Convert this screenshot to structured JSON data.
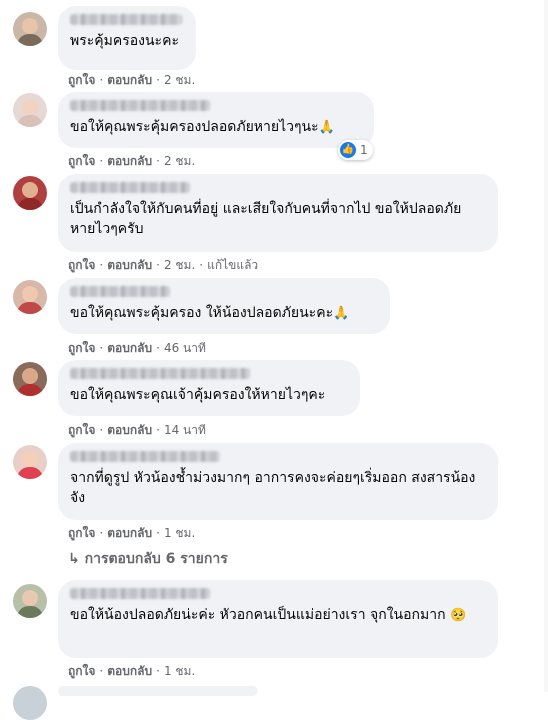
{
  "actions": {
    "like": "ถูกใจ",
    "reply": "ตอบกลับ",
    "separator": "·"
  },
  "comments": [
    {
      "text": "พระคุ้มครองนะคะ",
      "time": "2 ชม.",
      "edited": ""
    },
    {
      "text": "ขอให้คุณพระคุ้มครองปลอดภัยหายไวๆนะ",
      "emoji": "🙏",
      "time": "2 ชม.",
      "reactions": "1"
    },
    {
      "text": "เป็นกำลังใจให้กับคนที่อยู่ และเสียใจกับคนที่จากไป ขอให้ปลอดภัยหายไวๆครับ",
      "time": "2 ชม.",
      "edited": "แก้ไขแล้ว"
    },
    {
      "text": "ขอให้คุณพระคุ้มครอง ให้น้องปลอดภัยนะคะ",
      "emoji": "🙏",
      "time": "46 นาที"
    },
    {
      "text": "ขอให้คุณพระคุณเจ้าคุ้มครองให้หายไวๆคะ",
      "time": "14 นาที"
    },
    {
      "text": "จากที่ดูรูป หัวน้องช้ำม่วงมากๆ อาการคงจะค่อยๆเริ่มออก สงสารน้องจัง",
      "time": "1 ชม."
    },
    {
      "text": "ขอให้น้องปลอดภัยน่ะค่ะ หัวอกคนเป็นแม่อย่างเรา จุกในอกมาก",
      "emoji": "🥺",
      "time": "1 ชม."
    }
  ],
  "replies_link": "↳ การตอบกลับ 6 รายการ",
  "colors": {
    "bubble": "#f0f2f5",
    "meta": "#65676b",
    "like": "#1877f2"
  }
}
